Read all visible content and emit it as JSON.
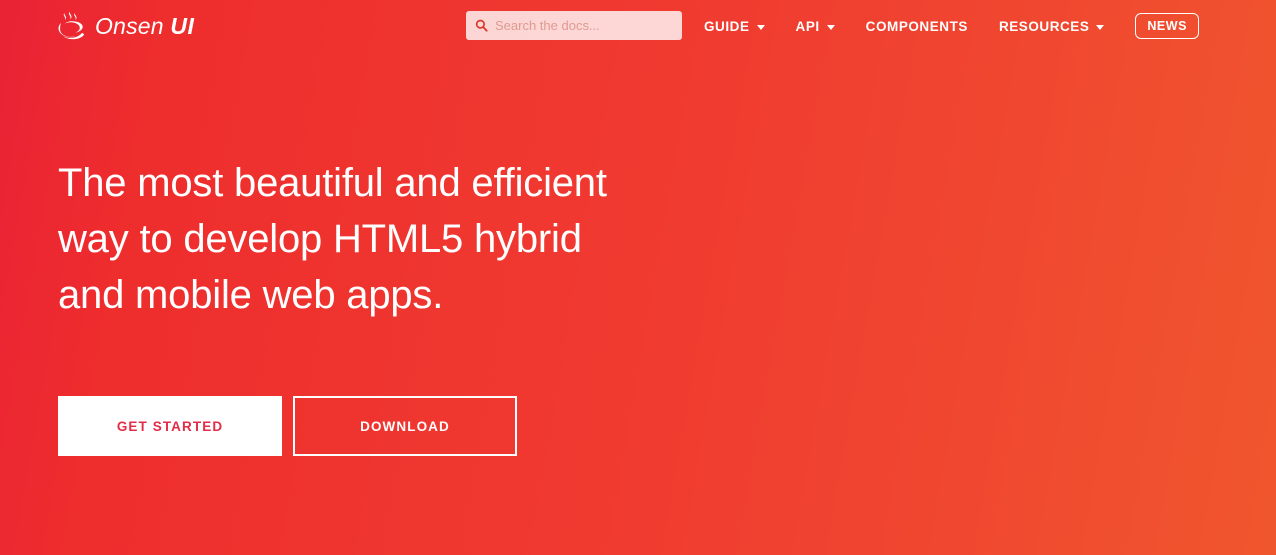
{
  "header": {
    "brand": {
      "icon": "onsen-hotspring-logo-icon",
      "name_light": "Onsen",
      "name_bold": "UI"
    },
    "search": {
      "icon": "search-icon",
      "value": "",
      "placeholder": "Search the docs..."
    },
    "nav": [
      {
        "label": "GUIDE",
        "has_dropdown": true
      },
      {
        "label": "API",
        "has_dropdown": true
      },
      {
        "label": "COMPONENTS",
        "has_dropdown": false
      },
      {
        "label": "RESOURCES",
        "has_dropdown": true
      }
    ],
    "news_button": "NEWS"
  },
  "hero": {
    "headline_lines": [
      "The most beautiful and efficient",
      "way to develop HTML5 hybrid",
      "and mobile web apps."
    ],
    "buttons": {
      "primary": "GET STARTED",
      "secondary": "DOWNLOAD"
    }
  },
  "colors": {
    "gradient_start": "#ee2d2d",
    "gradient_mid": "#f03a30",
    "gradient_end": "#f0562e",
    "primary_button_text": "#e32c46",
    "text_on_red": "#ffffff",
    "search_background": "#f7d2cc",
    "search_placeholder": "#e09a92"
  }
}
